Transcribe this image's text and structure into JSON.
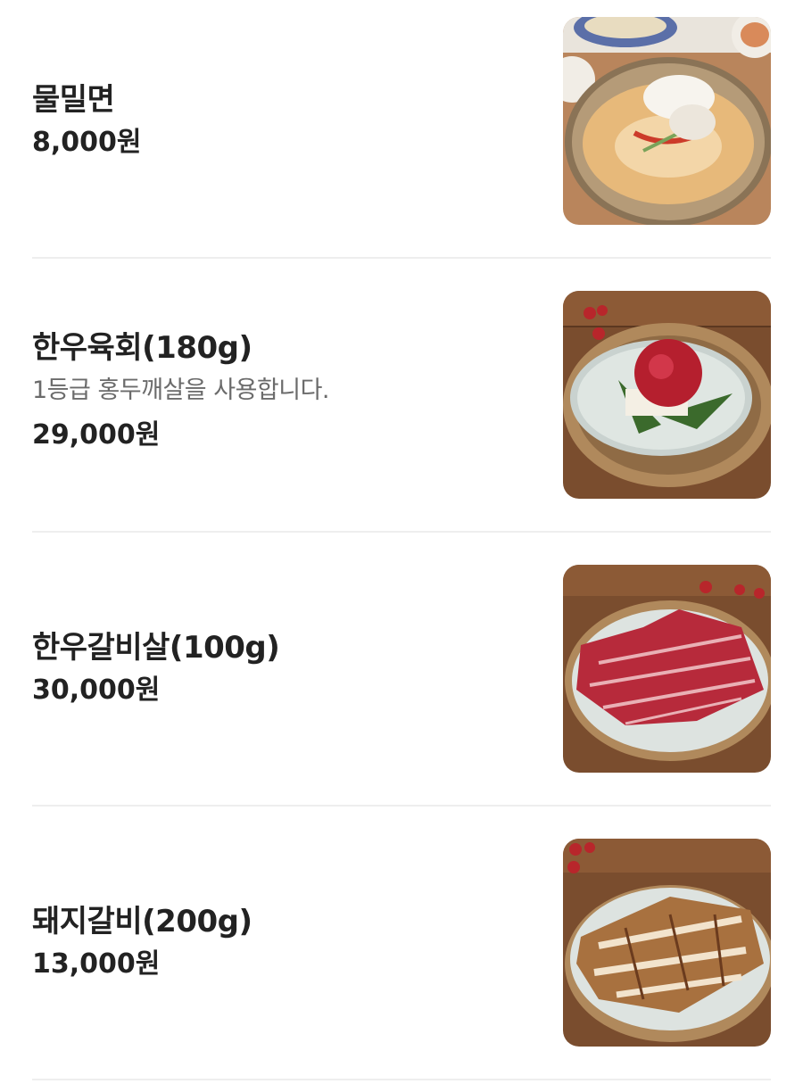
{
  "menu": {
    "items": [
      {
        "name": "물밀면",
        "description": "",
        "price": "8,000원",
        "photo": "mulmilmyeon-photo"
      },
      {
        "name": "한우육회(180g)",
        "description": "1등급 홍두깨살을 사용합니다.",
        "price": "29,000원",
        "photo": "hanwoo-yukhoe-photo"
      },
      {
        "name": "한우갈비살(100g)",
        "description": "",
        "price": "30,000원",
        "photo": "hanwoo-galbisal-photo"
      },
      {
        "name": "돼지갈비(200g)",
        "description": "",
        "price": "13,000원",
        "photo": "pork-galbi-photo"
      }
    ]
  },
  "colors": {
    "text_primary": "#222222",
    "text_secondary": "#6b6b6b",
    "divider": "#eeeeee",
    "background": "#ffffff"
  }
}
